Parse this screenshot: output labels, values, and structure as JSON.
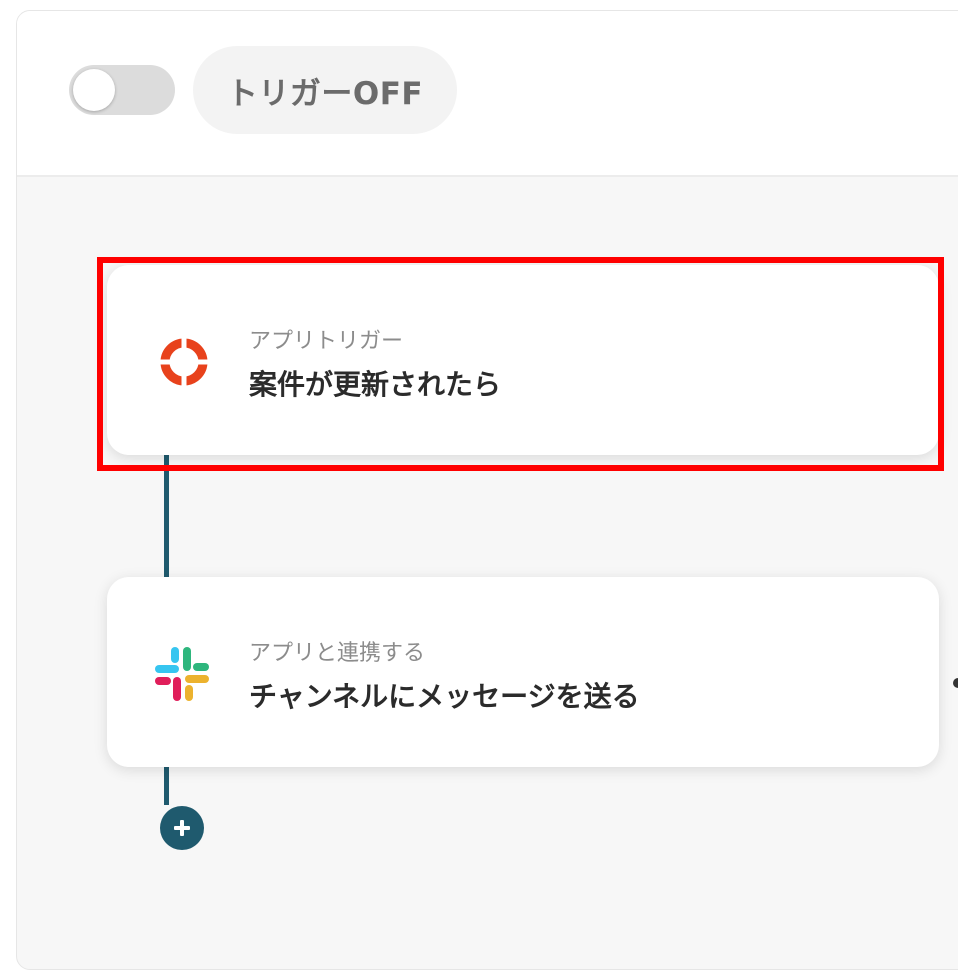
{
  "header": {
    "toggle_state": "off",
    "trigger_status_label": "トリガーOFF"
  },
  "flow": {
    "steps": [
      {
        "subtitle": "アプリトリガー",
        "title": "案件が更新されたら",
        "icon": "lifebuoy-ring-icon",
        "highlighted": true
      },
      {
        "subtitle": "アプリと連携する",
        "title": "チャンネルにメッセージを送る",
        "icon": "slack-icon",
        "highlighted": false
      }
    ],
    "add_step_icon": "plus-icon"
  },
  "colors": {
    "connector": "#1f5a6e",
    "highlight": "#ff0000",
    "trigger_icon": "#e8421c",
    "slack_blue": "#36c5f0",
    "slack_green": "#2eb67d",
    "slack_yellow": "#ecb22e",
    "slack_red": "#e01e5a"
  }
}
